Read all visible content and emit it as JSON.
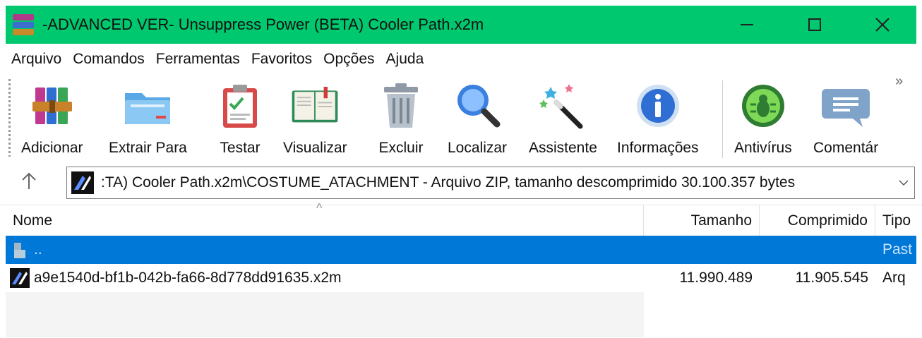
{
  "window": {
    "title": "-ADVANCED VER- Unsuppress Power (BETA) Cooler Path.x2m",
    "accent_color": "#00c86e",
    "icon": "winrar-books-icon"
  },
  "menu": [
    "Arquivo",
    "Comandos",
    "Ferramentas",
    "Favoritos",
    "Opções",
    "Ajuda"
  ],
  "toolbar": {
    "items": [
      {
        "label": "Adicionar",
        "icon": "add-archive-icon"
      },
      {
        "label": "Extrair Para",
        "icon": "extract-folder-icon"
      },
      {
        "label": "Testar",
        "icon": "test-clipboard-icon"
      },
      {
        "label": "Visualizar",
        "icon": "view-book-icon"
      },
      {
        "label": "Excluir",
        "icon": "delete-trash-icon"
      },
      {
        "label": "Localizar",
        "icon": "find-magnifier-icon"
      },
      {
        "label": "Assistente",
        "icon": "wizard-wand-icon"
      },
      {
        "label": "Informações",
        "icon": "info-icon"
      },
      {
        "label": "Antivírus",
        "icon": "antivirus-bug-icon"
      },
      {
        "label": "Comentár",
        "icon": "comment-bubble-icon"
      }
    ],
    "overflow": "»"
  },
  "address": {
    "text": ":TA) Cooler Path.x2m\\COSTUME_ATACHMENT - Arquivo ZIP, tamanho descomprimido 30.100.357 bytes"
  },
  "columns": {
    "name": "Nome",
    "size": "Tamanho",
    "packed": "Comprimido",
    "type": "Tipo"
  },
  "rows": [
    {
      "name": "..",
      "size": "",
      "packed": "",
      "type": "Past",
      "selected": true
    },
    {
      "name": "a9e1540d-bf1b-042b-fa66-8d778dd91635.x2m",
      "size": "11.990.489",
      "packed": "11.905.545",
      "type": "Arq"
    }
  ],
  "colors": {
    "selection": "#0078d7",
    "titlebar": "#00c86e"
  }
}
